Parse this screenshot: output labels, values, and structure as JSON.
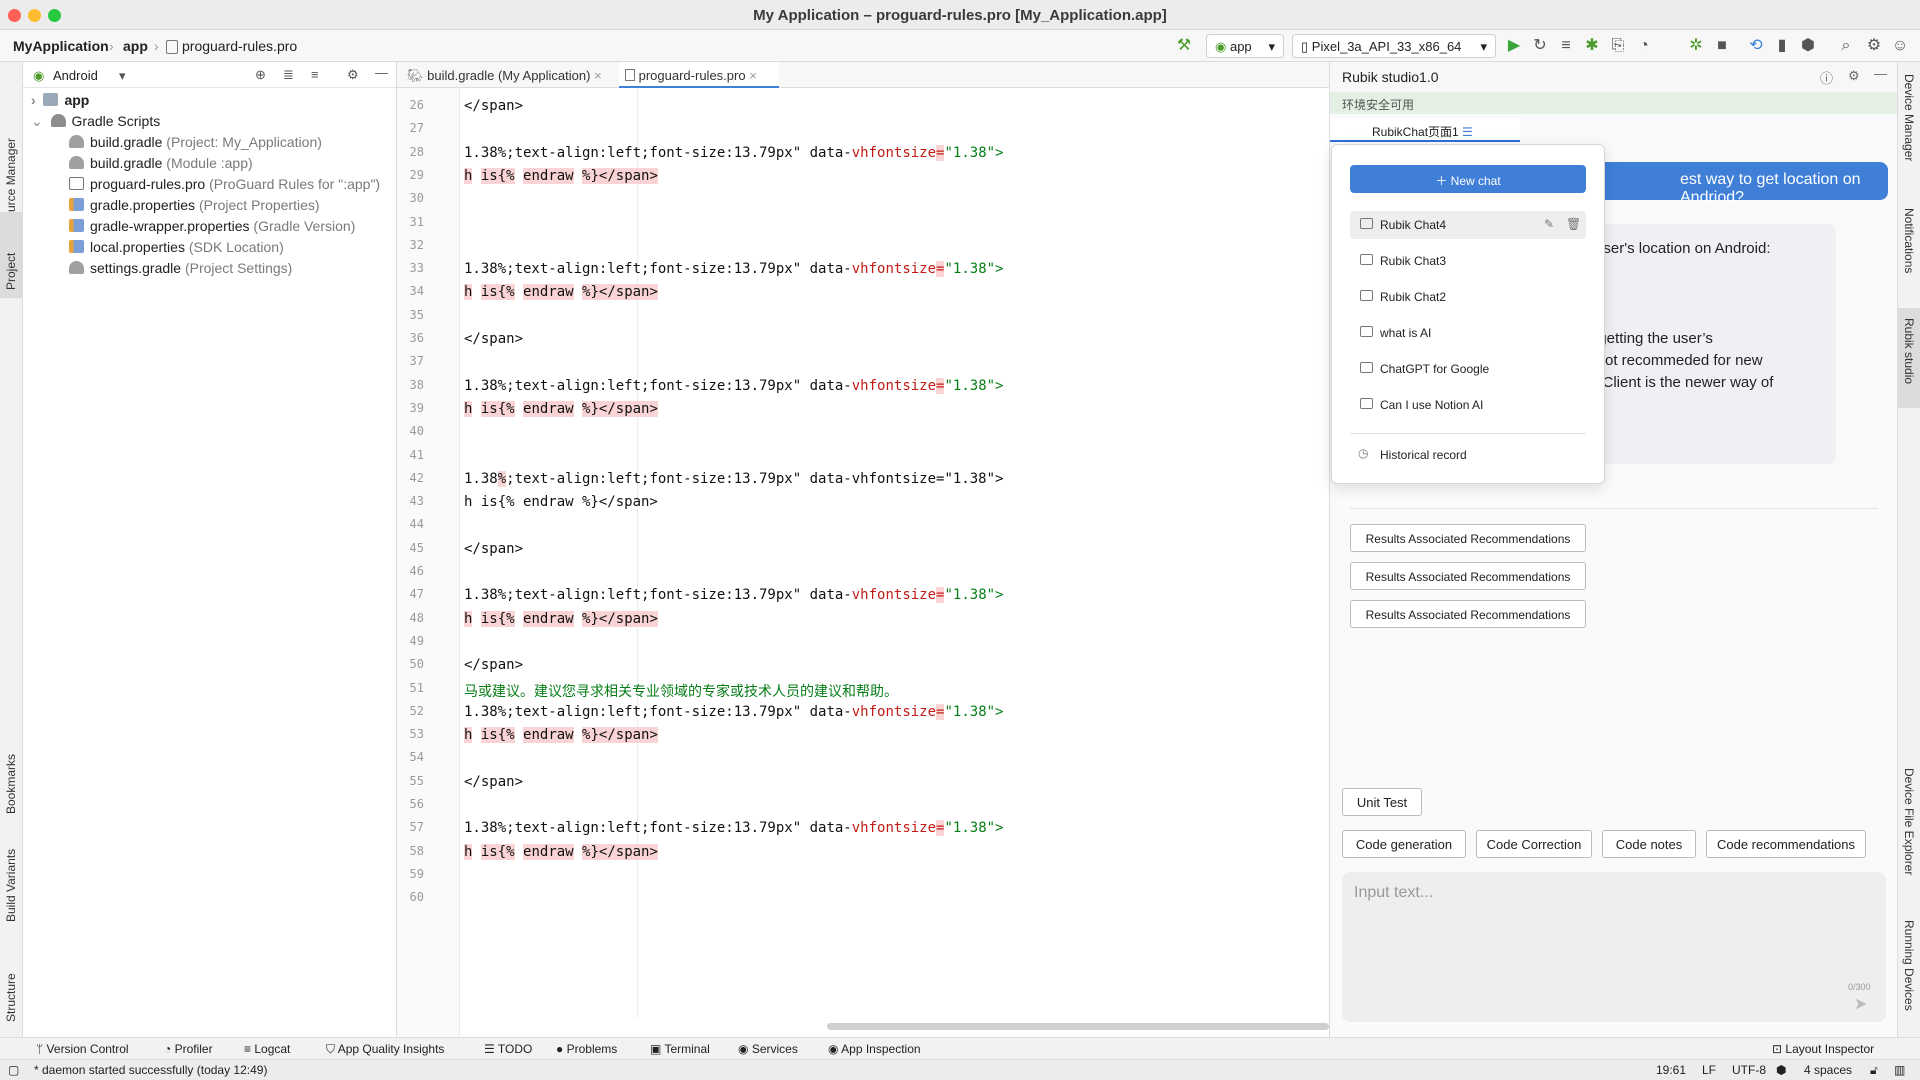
{
  "window": {
    "title": "My Application – proguard-rules.pro [My_Application.app]"
  },
  "toolbar": {
    "breadcrumbs": [
      "MyApplication",
      "app",
      "proguard-rules.pro"
    ],
    "run_config": "app",
    "device": "Pixel_3a_API_33_x86_64"
  },
  "left_strip": {
    "labels": [
      "Resource Manager",
      "Project",
      "Bookmarks",
      "Build Variants",
      "Structure"
    ]
  },
  "right_strip": {
    "labels": [
      "Device Manager",
      "Notifications",
      "Rubik studio",
      "Device File Explorer",
      "Running Devices"
    ]
  },
  "project": {
    "view": "Android",
    "tree": [
      {
        "name": "app",
        "hint": ""
      },
      {
        "name": "Gradle Scripts",
        "hint": ""
      },
      {
        "name": "build.gradle",
        "hint": "(Project: My_Application)"
      },
      {
        "name": "build.gradle",
        "hint": "(Module :app)"
      },
      {
        "name": "proguard-rules.pro",
        "hint": "(ProGuard Rules for \":app\")"
      },
      {
        "name": "gradle.properties",
        "hint": "(Project Properties)"
      },
      {
        "name": "gradle-wrapper.properties",
        "hint": "(Gradle Version)"
      },
      {
        "name": "local.properties",
        "hint": "(SDK Location)"
      },
      {
        "name": "settings.gradle",
        "hint": "(Project Settings)"
      }
    ]
  },
  "editor": {
    "tabs": [
      "build.gradle (My Application)",
      "proguard-rules.pro"
    ],
    "active_tab": "proguard-rules.pro",
    "line_numbers": [
      "26",
      "27",
      "28",
      "29",
      "30",
      "31",
      "32",
      "33",
      "34",
      "35",
      "36",
      "37",
      "38",
      "39",
      "40",
      "41",
      "42",
      "43",
      "44",
      "45",
      "46",
      "47",
      "48",
      "49",
      "50",
      "51",
      "52",
      "53",
      "54",
      "55",
      "56",
      "57",
      "58",
      "59",
      "60"
    ],
    "style_frag": "1.38%;text-align:left;font-size:13.79px\"",
    "attr_prefix": "data-",
    "attr_name": "vhfontsize",
    "attr_eq": "=",
    "attr_val": "\"1.38\">",
    "h": "h",
    "is": "is{%",
    "endraw": "endraw",
    "close_tag": "%}</span>",
    "span_close": "</span>",
    "plain_line_42": "1.38",
    "plain_pct": "%",
    "plain_rest_42": ";text-align:left;font-size:13.79px\" data-vhfontsize=\"1.38\">",
    "plain_line_43": "h is{% endraw %}</span>",
    "chinese": "马或建议。建议您寻求相关专业领域的专家或技术人员的建议和帮助。"
  },
  "rubik": {
    "title": "Rubik studio1.0",
    "env_notice": "环境安全可用",
    "page_tab": "RubikChat页面1",
    "user_message": "est way to get location on Andriod?",
    "bot_lines": [
      "the user's location on Android:",
      "y of getting the user’s",
      "it is not recommeded for new",
      "viderClient is the newer way of"
    ],
    "recommendations": [
      "Results Associated Recommendations",
      "Results Associated Recommendations",
      "Results Associated Recommendations"
    ],
    "actions": [
      "Unit Test",
      "Code generation",
      "Code Correction",
      "Code notes",
      "Code recommendations"
    ],
    "input_placeholder": "Input text...",
    "char_count": "0/300",
    "dropdown": {
      "new_chat": "New chat",
      "chats": [
        "Rubik Chat4",
        "Rubik Chat3",
        "Rubik Chat2",
        "what is AI",
        "ChatGPT for Google",
        "Can I use Notion AI"
      ],
      "history": "Historical record"
    }
  },
  "bottom_tools": [
    "Version Control",
    "Profiler",
    "Logcat",
    "App Quality Insights",
    "TODO",
    "Problems",
    "Terminal",
    "Services",
    "App Inspection",
    "Layout Inspector"
  ],
  "status": {
    "message": "* daemon started successfully (today 12:49)",
    "position": "19:61",
    "line_sep": "LF",
    "encoding": "UTF-8",
    "indent": "4 spaces"
  },
  "colors": {
    "accent": "#3f7fd8",
    "highlight": "#fad4d4",
    "string": "#067d17",
    "attr": "#c41a16"
  }
}
